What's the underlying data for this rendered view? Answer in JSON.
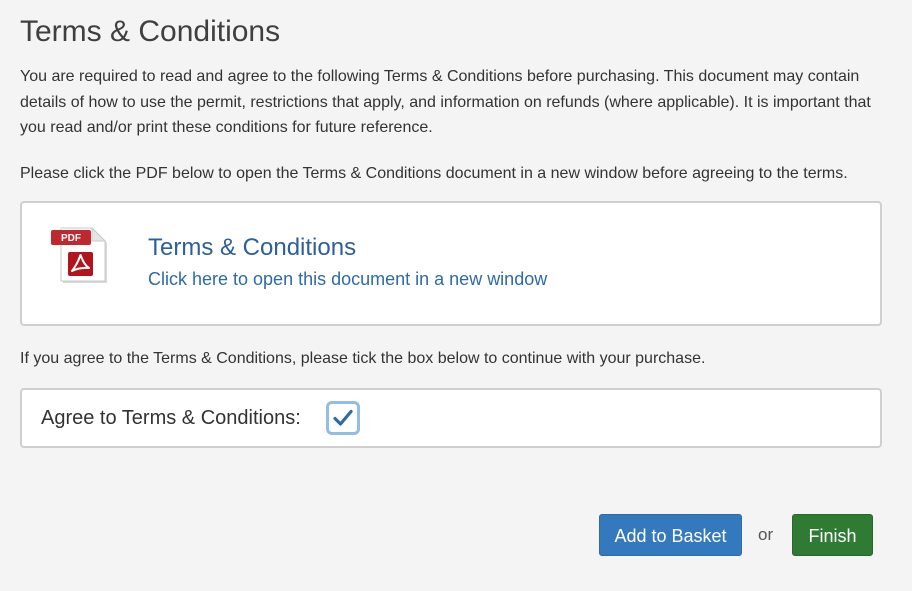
{
  "page": {
    "title": "Terms & Conditions",
    "intro": "You are required to read and agree to the following Terms & Conditions before purchasing. This document may contain details of how to use the permit, restrictions that apply, and information on refunds (where applicable). It is important that you read and/or print these conditions for future reference.",
    "instruction": "Please click the PDF below to open the Terms & Conditions document in a new window before agreeing to the terms."
  },
  "document": {
    "icon": "pdf-icon",
    "icon_badge": "PDF",
    "title": "Terms & Conditions",
    "link_text": "Click here to open this document in a new window"
  },
  "agreement": {
    "note": "If you agree to the Terms & Conditions, please tick the box below to continue with your purchase.",
    "label": "Agree to Terms & Conditions:",
    "checked": true
  },
  "actions": {
    "add_to_basket": "Add to Basket",
    "or": "or",
    "finish": "Finish"
  },
  "colors": {
    "link": "#2e6aa8",
    "primary_button": "#3479bd",
    "success_button": "#2f7b34",
    "checkbox_focus": "#93bce6"
  }
}
